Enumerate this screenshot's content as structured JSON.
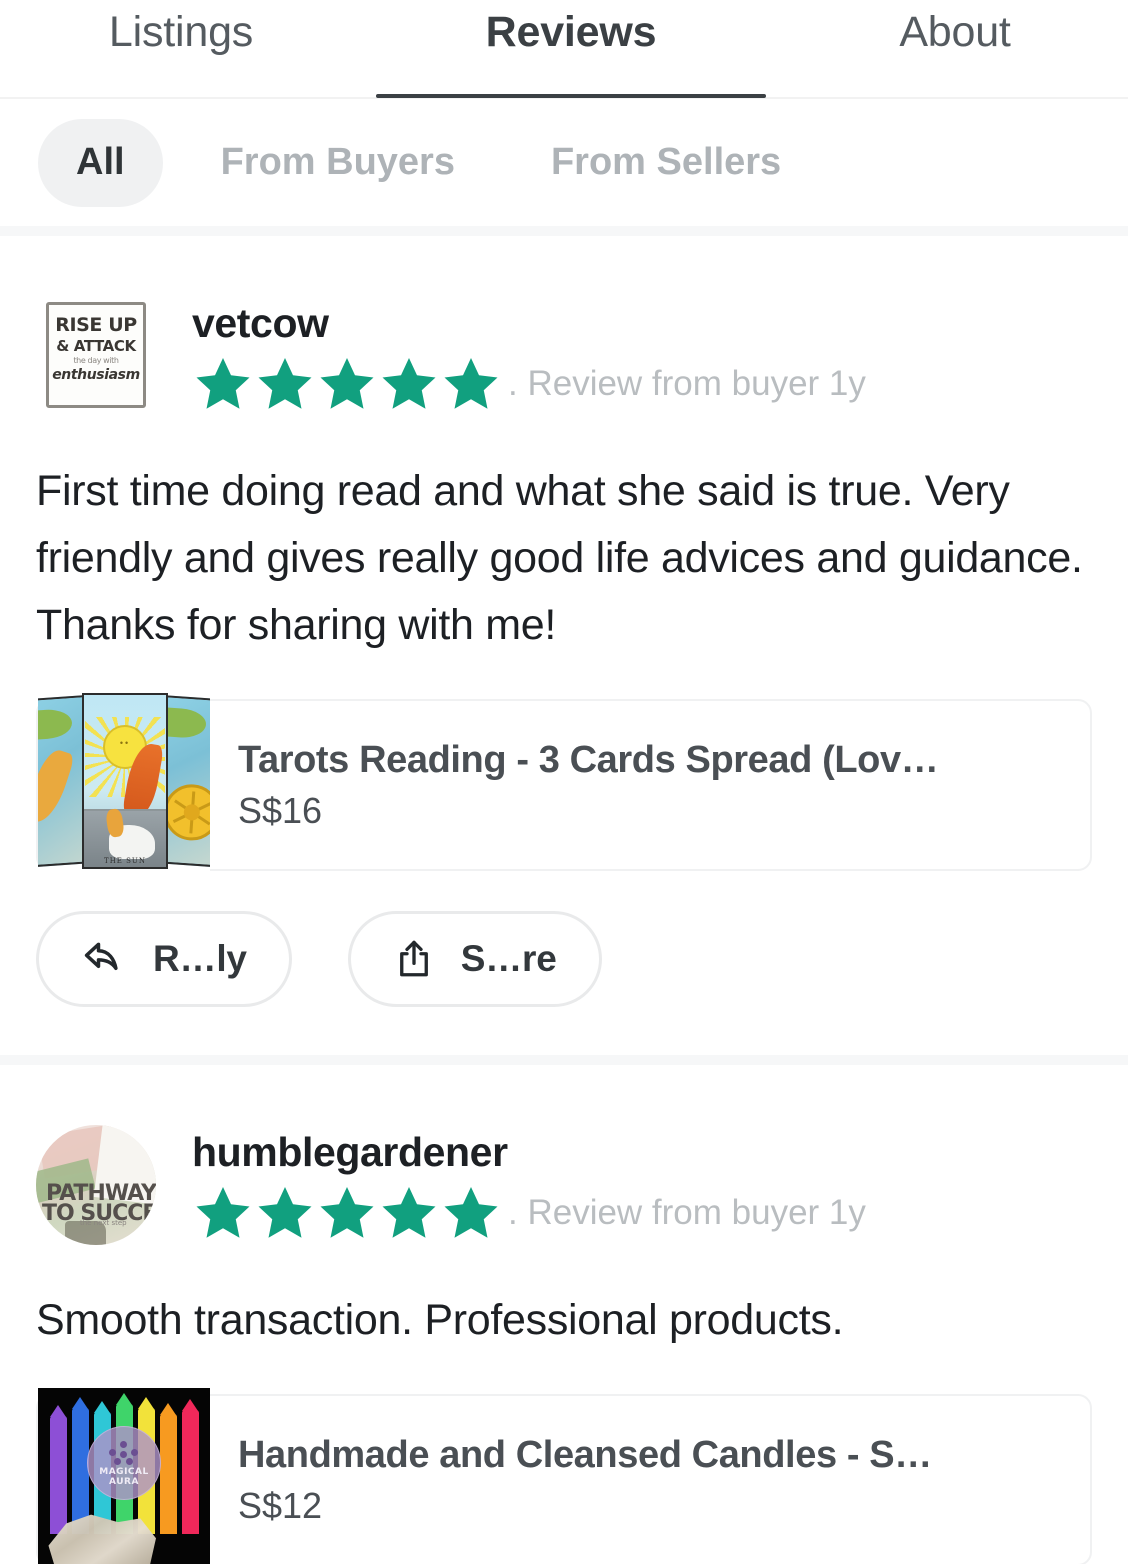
{
  "colors": {
    "star": "#11a07f",
    "accent": "#3b4044",
    "muted": "#b9bdc0",
    "chip_bg": "#f0f1f2",
    "separator": "#f6f7f8"
  },
  "tabs": [
    {
      "id": "listings",
      "label": "Listings",
      "active": false
    },
    {
      "id": "reviews",
      "label": "Reviews",
      "active": true
    },
    {
      "id": "about",
      "label": "About",
      "active": false
    }
  ],
  "filters": [
    {
      "id": "all",
      "label": "All",
      "active": true
    },
    {
      "id": "from-buyers",
      "label": "From Buyers",
      "active": false
    },
    {
      "id": "from-sellers",
      "label": "From Sellers",
      "active": false
    }
  ],
  "reviews": [
    {
      "username": "vetcow",
      "rating": 5,
      "rating_stars": "★★★★★",
      "meta": ". Review from buyer 1y",
      "body": "First time doing read and what she said is true. Very friendly and gives really good life advices and guidance. Thanks for sharing with me!",
      "avatar": {
        "type": "sign-image",
        "name": "rise-up-sign-avatar",
        "line1": "RISE UP",
        "line2": "& ATTACK",
        "line3": "the day with",
        "line4": "enthusiasm"
      },
      "product": {
        "title": "Tarots Reading - 3 Cards Spread (Lov…",
        "price": "S$16",
        "thumb": {
          "type": "tarot-cards",
          "name": "tarot-cards-thumbnail",
          "card_label": "THE SUN"
        }
      },
      "actions": [
        {
          "id": "reply",
          "label": "R…ly",
          "icon": "reply-arrow-icon"
        },
        {
          "id": "share",
          "label": "S…re",
          "icon": "share-upload-icon"
        }
      ]
    },
    {
      "username": "humblegardener",
      "rating": 5,
      "rating_stars": "★★★★★",
      "meta": ". Review from buyer 1y",
      "body": "Smooth transaction. Professional products.",
      "avatar": {
        "type": "book-photo",
        "name": "pathway-to-success-avatar",
        "line1": "PATHWAY",
        "line2": "TO SUCCESS",
        "line3": "the next step"
      },
      "product": {
        "title": "Handmade and Cleansed Candles - S…",
        "price": "S$12",
        "thumb": {
          "type": "rainbow-candles",
          "name": "rainbow-candles-thumbnail",
          "logo_line1": "MAGICAL",
          "logo_line2": "AURA",
          "candle_colors": [
            "#8d4fd6",
            "#2f6ee0",
            "#2fc7d6",
            "#3fd46a",
            "#f2e23a",
            "#f79a20",
            "#f0285a"
          ]
        }
      },
      "actions": []
    }
  ]
}
